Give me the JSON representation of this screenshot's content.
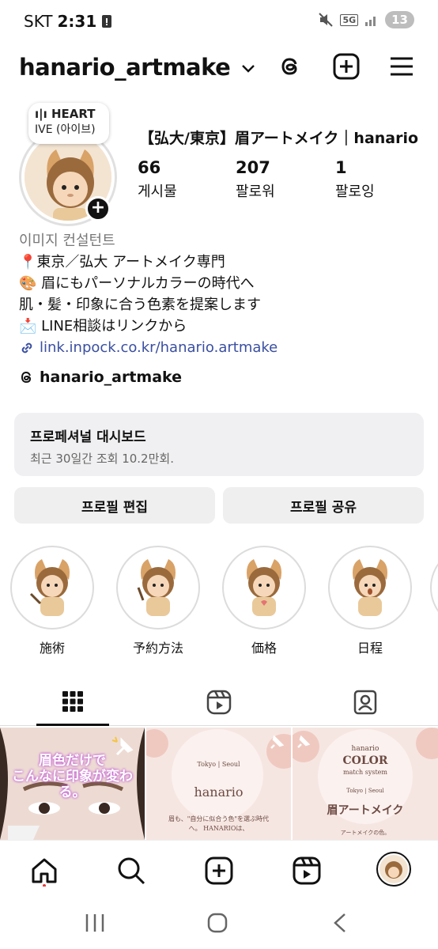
{
  "status_bar": {
    "carrier": "SKT",
    "time": "2:31",
    "notification_count": "13",
    "network": "5G"
  },
  "header": {
    "username": "hanario_artmake",
    "icons": [
      "threads-icon",
      "create-icon",
      "menu-icon"
    ]
  },
  "note": {
    "line1": "HEART",
    "line2": "IVE (아이브)"
  },
  "profile": {
    "display_name": "【弘大/東京】眉アートメイク｜hanario",
    "stats": [
      {
        "value": "66",
        "label": "게시물"
      },
      {
        "value": "207",
        "label": "팔로워"
      },
      {
        "value": "1",
        "label": "팔로잉"
      }
    ],
    "category": "이미지 컨설턴트",
    "bio": [
      "📍東京／弘大 アートメイク専門",
      "🎨 眉にもパーソナルカラーの時代へ",
      "肌・髪・印象に合う色素を提案します",
      "📩 LINE相談はリンクから"
    ],
    "link": "link.inpock.co.kr/hanario.artmake",
    "threads_handle": "hanario_artmake"
  },
  "dashboard": {
    "title": "프로페셔널 대시보드",
    "subtitle": "최근 30일간 조회 10.2만회."
  },
  "buttons": {
    "edit": "프로필 편집",
    "share": "프로필 공유"
  },
  "highlights": [
    {
      "label": "施術"
    },
    {
      "label": "予約方法"
    },
    {
      "label": "価格"
    },
    {
      "label": "日程"
    }
  ],
  "posts": [
    {
      "caption": "眉色だけで\nこんなに印象が変わる。"
    },
    {
      "header": "Tokyo | Seoul",
      "title": "hanario",
      "body": "眉も、\"自分に似合う色\"を選ぶ時代へ。 HANARIOは、"
    },
    {
      "brand": "hanario",
      "title": "COLOR",
      "subtitle": "match system",
      "header": "Tokyo | Seoul",
      "main": "眉アートメイク",
      "foot": "アートメイクの色。"
    }
  ],
  "colors": {
    "link": "#3a4fa0",
    "badge": "#111111",
    "muted": "#777777",
    "accent_notif": "#e53935"
  }
}
